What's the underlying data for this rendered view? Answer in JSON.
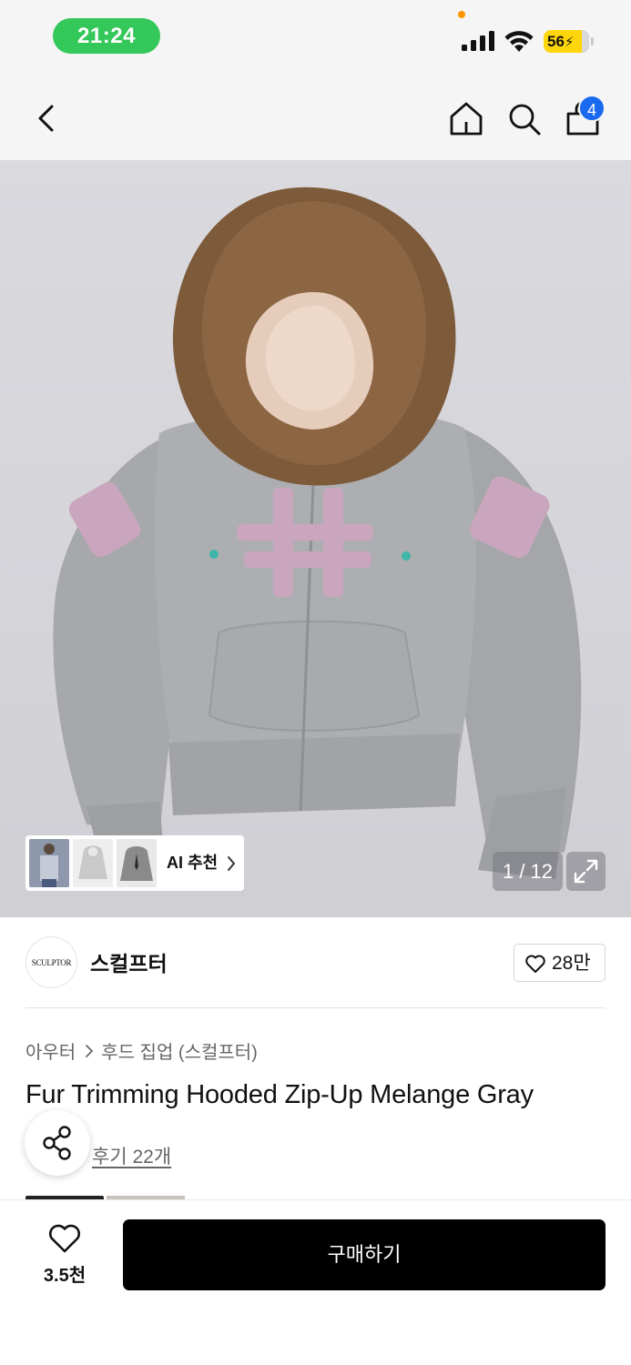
{
  "status_bar": {
    "time": "21:24",
    "battery": "56",
    "icons": [
      "cellular-signal-icon",
      "wifi-icon",
      "battery-charging-icon"
    ]
  },
  "nav": {
    "icons": [
      "back-chevron-icon",
      "home-icon",
      "search-icon",
      "shopping-bag-icon"
    ],
    "cart_count": "4"
  },
  "gallery": {
    "ai_recommend_label": "AI 추천",
    "counter": "1 / 12",
    "expand_icon": "expand-arrows-icon",
    "thumbnails": 3
  },
  "brand": {
    "logo_text": "SCULPTOR",
    "name": "스컬프터",
    "likes": "28만"
  },
  "product": {
    "breadcrumb": [
      "아우터",
      "후드 집업 (스컬프터)"
    ],
    "title": "Fur Trimming Hooded Zip-Up Melange Gray",
    "review_link": "후기 22개"
  },
  "bottom_bar": {
    "wish_count": "3.5천",
    "buy_label": "구매하기"
  },
  "colors": {
    "accent_green": "#34c759",
    "badge_blue": "#1a6af0",
    "battery_yellow": "#ffd60a",
    "buy_button": "#000000"
  }
}
